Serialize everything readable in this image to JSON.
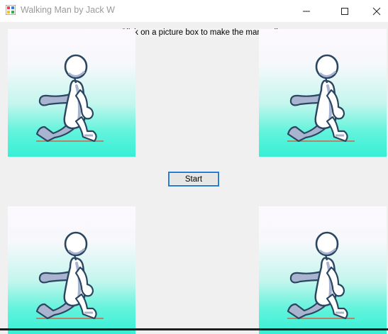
{
  "window": {
    "title": "Walking Man by Jack W",
    "controls": {
      "minimize": "minimize-icon",
      "maximize": "maximize-icon",
      "close": "close-icon"
    }
  },
  "main": {
    "instruction": "Click on a picture box to make the man walk",
    "start_label": "Start",
    "picture_boxes": [
      {
        "name": "top-left",
        "image": "walking-man"
      },
      {
        "name": "top-right",
        "image": "walking-man"
      },
      {
        "name": "bottom-left",
        "image": "walking-man"
      },
      {
        "name": "bottom-right",
        "image": "walking-man"
      }
    ]
  },
  "colors": {
    "gradient_top": "#fdf9fe",
    "gradient_bottom": "#36f0d6",
    "button_focus_border": "#2b7bd2",
    "figure_outline": "#2a4660",
    "figure_fill": "#ffffff",
    "figure_shade": "#a9b5d0",
    "ground": "#b8826b"
  }
}
